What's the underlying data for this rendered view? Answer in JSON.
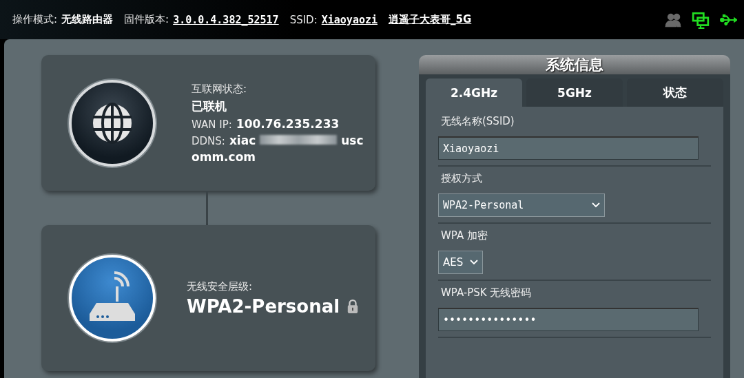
{
  "top_bar": {
    "mode_label": "操作模式:",
    "mode_value": "无线路由器",
    "firmware_label": "固件版本:",
    "firmware_value": "3.0.0.4.382_52517",
    "ssid_label": "SSID:",
    "ssids": [
      "Xiaoyaozi",
      "逍遥子大表哥_5G"
    ],
    "status_icons": [
      {
        "kind": "clients",
        "active": false
      },
      {
        "kind": "network",
        "active": true
      },
      {
        "kind": "usb",
        "active": true
      }
    ]
  },
  "internet_card": {
    "status_label": "互联网状态:",
    "status_value": "已联机",
    "wan_label": "WAN IP:",
    "wan_value": "100.76.235.233",
    "ddns_label": "DDNS:",
    "ddns_line1_start": "xiac",
    "ddns_line1_end": "usc",
    "ddns_line2": "omm.com"
  },
  "wireless_card": {
    "security_label": "无线安全层级:",
    "security_value": "WPA2-Personal"
  },
  "system_info": {
    "title": "系统信息",
    "tabs": [
      {
        "label": "2.4GHz",
        "selected": true
      },
      {
        "label": "5GHz",
        "selected": false
      },
      {
        "label": "状态",
        "selected": false
      }
    ],
    "fields": [
      {
        "kind": "text",
        "label": "无线名称(SSID)",
        "value": "Xiaoyaozi"
      },
      {
        "kind": "select",
        "label": "授权方式",
        "value": "WPA2-Personal"
      },
      {
        "kind": "select-small",
        "label": "WPA 加密",
        "value": "AES"
      },
      {
        "kind": "password",
        "label": "WPA-PSK 无线密码",
        "value": "•••••••••••••••"
      }
    ]
  }
}
